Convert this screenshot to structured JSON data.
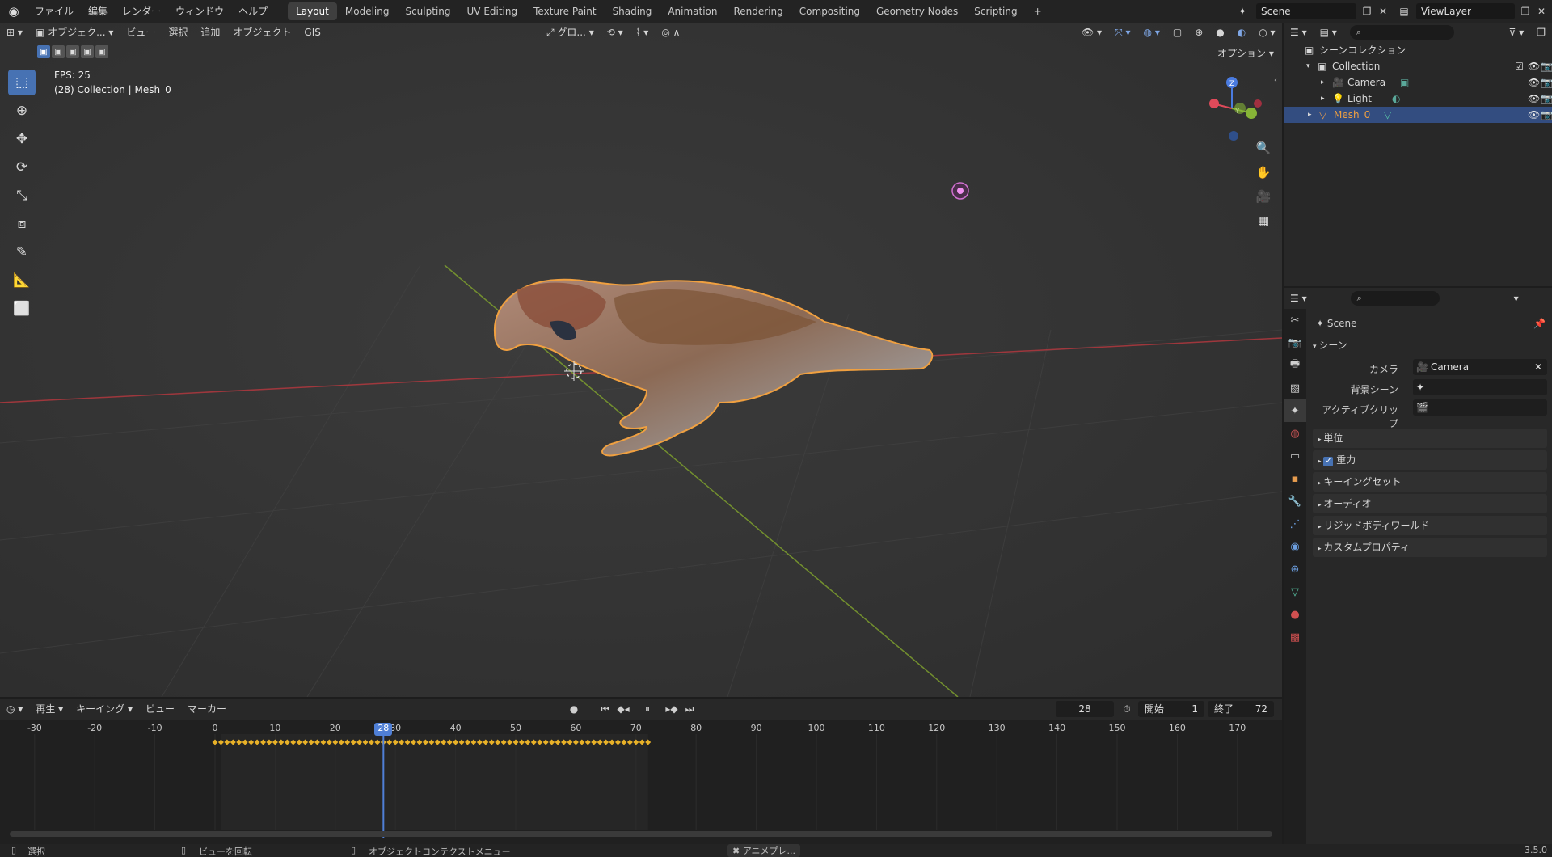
{
  "menu": [
    "ファイル",
    "編集",
    "レンダー",
    "ウィンドウ",
    "ヘルプ"
  ],
  "workspaces": [
    "Layout",
    "Modeling",
    "Sculpting",
    "UV Editing",
    "Texture Paint",
    "Shading",
    "Animation",
    "Rendering",
    "Compositing",
    "Geometry Nodes",
    "Scripting"
  ],
  "active_workspace": "Layout",
  "add_workspace": "+",
  "scene_name": "Scene",
  "view_layer": "ViewLayer",
  "viewport": {
    "mode": "オブジェク...",
    "menus": [
      "ビュー",
      "選択",
      "追加",
      "オブジェクト",
      "GIS"
    ],
    "transform_orientation": "グロ...",
    "options_label": "オプション",
    "fps": "FPS: 25",
    "info": "(28) Collection | Mesh_0",
    "gizmo_z": "Z",
    "gizmo_y": "Y"
  },
  "outliner": {
    "root": "シーンコレクション",
    "collection": "Collection",
    "items": [
      "Camera",
      "Light",
      "Mesh_0"
    ],
    "selected": "Mesh_0"
  },
  "properties": {
    "title": "Scene",
    "section": "シーン",
    "camera_label": "カメラ",
    "camera_value": "Camera",
    "bg_scene_label": "背景シーン",
    "active_clip_label": "アクティブクリップ",
    "panels": [
      "単位",
      "重力",
      "キーイングセット",
      "オーディオ",
      "リジッドボディワールド",
      "カスタムプロパティ"
    ],
    "gravity_checked": true
  },
  "timeline": {
    "menus": [
      "再生",
      "キーイング",
      "ビュー",
      "マーカー"
    ],
    "current_frame": "28",
    "start_label": "開始",
    "start": "1",
    "end_label": "終了",
    "end": "72",
    "ruler": [
      "-30",
      "-20",
      "-10",
      "0",
      "10",
      "20",
      "30",
      "40",
      "50",
      "60",
      "70",
      "80",
      "90",
      "100",
      "110",
      "120",
      "130",
      "140",
      "150",
      "160",
      "170"
    ],
    "ruler_values": [
      -30,
      -20,
      -10,
      0,
      10,
      20,
      30,
      40,
      50,
      60,
      70,
      80,
      90,
      100,
      110,
      120,
      130,
      140,
      150,
      160,
      170
    ],
    "current_frame_value": 28,
    "keyframe_first": 0,
    "keyframe_last": 72
  },
  "status": {
    "select": "選択",
    "rotate": "ビューを回転",
    "context_menu": "オブジェクトコンテクストメニュー",
    "anim": "アニメプレ...",
    "version": "3.5.0"
  },
  "colors": {
    "accent": "#4772b3",
    "keyframe": "#e8b128",
    "selection_outline": "#f0a040",
    "axis_x": "#b9383f",
    "axis_y": "#7a9a2e",
    "playhead": "#4f7fd6"
  }
}
